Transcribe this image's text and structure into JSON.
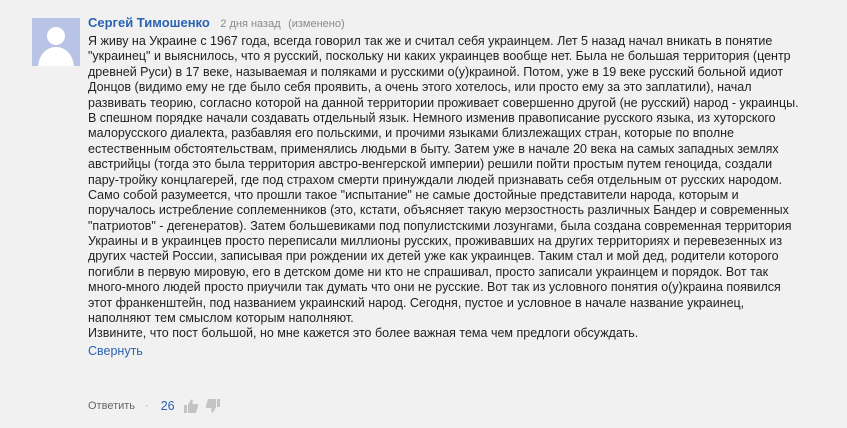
{
  "comment": {
    "author": "Сергей Тимошенко",
    "timestamp": "2 дня назад",
    "edited": "(изменено)",
    "avatar_icon": "default-user-avatar",
    "lines": [
      "Я живу на Украине с 1967 года, всегда говорил так же и считал себя украинцем. Лет 5 назад начал вникать в понятие",
      "\"украинец\" и выяснилось, что я русский, поскольку ни каких украинцев вообще нет. Была не большая территория (центр",
      "древней Руси) в 17 веке, называемая и поляками и русскими о(у)краиной. Потом, уже в 19 веке русский больной идиот",
      "Донцов (видимо ему не где было себя проявить, а очень этого хотелось, или просто ему за это заплатили), начал",
      "развивать теорию, согласно которой на данной территории проживает совершенно другой (не русский) народ - украинцы.",
      "В спешном порядке начали создавать отдельный язык. Немного изменив правописание русского языка, из хуторского",
      "малорусского диалекта, разбавляя его польскими, и прочими языками близлежащих стран, которые по вполне",
      "естественным обстоятельствам, применялись людьми в быту. Затем уже в начале 20 века на самых западных землях",
      "австрийцы (тогда это была территория австро-венгерской империи) решили пойти простым путем геноцида, создали",
      "пару-тройку концлагерей, где под страхом смерти принуждали людей признавать себя отдельным от русских народом.",
      "Само собой разумеется, что прошли такое \"испытание\" не самые достойные представители народа, которым и",
      "поручалось истребление соплеменников (это, кстати, объясняет такую мерзостность различных Бандер и современных",
      "\"патриотов\" - дегенератов). Затем большевиками под популистскими лозунгами, была создана современная территория",
      "Украины и в украинцев просто переписали миллионы русских, проживавших на других территориях и перевезенных из",
      "других частей России, записывая при рождении их детей уже как украинцев. Таким стал и мой дед, родители которого",
      "погибли в первую мировую, его в детском доме ни кто не спрашивал, просто записали украинцем и порядок. Вот так",
      "много-много людей просто приучили так думать что они не русские. Вот так из условного понятия о(у)краина появился",
      "этот франкенштейн, под названием украинский народ. Сегодня, пустое и условное в начале название украинец,",
      "наполняют тем смыслом которым наполняют.",
      "Извините, что пост большой, но мне кажется это более важная тема чем предлоги обсуждать."
    ],
    "collapse_label": "Свернуть",
    "reply_label": "Ответить",
    "separator": "·",
    "like_count": "26",
    "like_icon": "thumbs-up-icon",
    "dislike_icon": "thumbs-down-icon"
  },
  "colors": {
    "background": "#f1f1f1",
    "link": "#2a63b1",
    "text": "#222222",
    "muted": "#8a8a8a",
    "avatar_bg": "#b8c3e6"
  }
}
